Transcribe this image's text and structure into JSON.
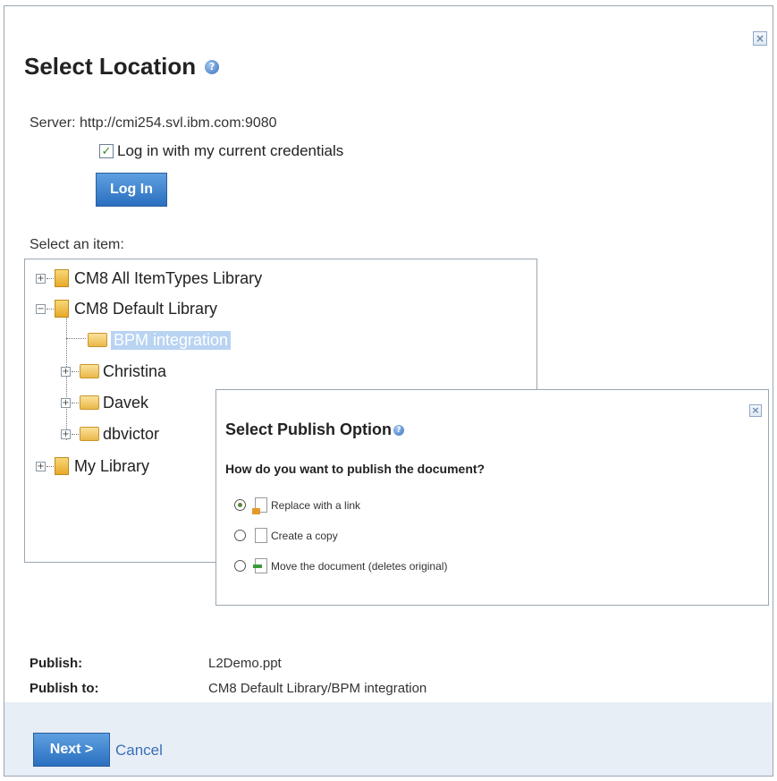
{
  "dialog": {
    "title": "Select Location",
    "help_glyph": "?",
    "close_glyph": "×",
    "server_text": "Server: http://cmi254.svl.ibm.com:9080",
    "credentials_label": "Log in with my current credentials",
    "credentials_checked": true,
    "login_button": "Log In",
    "select_label": "Select an item:"
  },
  "tree": {
    "nodes": [
      {
        "label": "CM8 All ItemTypes Library",
        "icon": "library-icon",
        "expander": "+"
      },
      {
        "label": "CM8 Default Library",
        "icon": "library-icon",
        "expander": "−"
      },
      {
        "label": "BPM integration",
        "icon": "folder-icon",
        "selected": true
      },
      {
        "label": "Christina",
        "icon": "folder-icon",
        "expander": "+"
      },
      {
        "label": "Davek",
        "icon": "folder-icon",
        "expander": "+"
      },
      {
        "label": "dbvictor",
        "icon": "folder-icon",
        "expander": "+"
      },
      {
        "label": "My Library",
        "icon": "library-icon",
        "expander": "+"
      }
    ]
  },
  "popup": {
    "title": "Select Publish Option",
    "help_glyph": "?",
    "close_glyph": "×",
    "question": "How do you want to publish the document?",
    "options": [
      {
        "label": "Replace with a link",
        "selected": true,
        "icon": "link-doc-icon"
      },
      {
        "label": "Create a copy",
        "selected": false,
        "icon": "copy-doc-icon"
      },
      {
        "label": "Move the document (deletes original)",
        "selected": false,
        "icon": "move-doc-icon"
      }
    ]
  },
  "summary": {
    "publish_label": "Publish:",
    "publish_value": "L2Demo.ppt",
    "publish_to_label": "Publish to:",
    "publish_to_value": "CM8 Default Library/BPM integration"
  },
  "footer": {
    "next_button": "Next >",
    "cancel_link": "Cancel"
  },
  "colors": {
    "accent": "#2a6fc0",
    "footer_bg": "#e8eef6",
    "selection": "#b9d3f2"
  }
}
